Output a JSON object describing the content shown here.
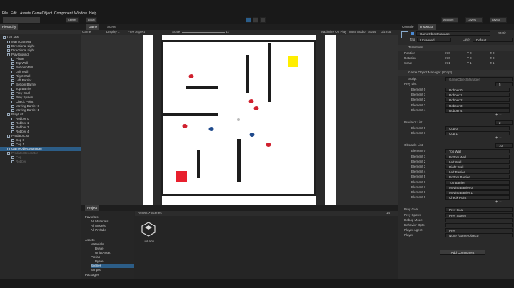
{
  "menu": [
    "File",
    "Edit",
    "Assets",
    "GameObject",
    "Component",
    "Window",
    "Help"
  ],
  "toolbar": {
    "account": "LinLab5",
    "center": "Center",
    "local": "Local",
    "account_btn": "Account",
    "layers": "Layers",
    "layout": "Layout"
  },
  "hierarchy": {
    "tab": "Hierarchy",
    "scene_tab": "Scene",
    "items": [
      {
        "label": "LinLab5",
        "indent": 0,
        "sel": false,
        "dim": false
      },
      {
        "label": "Main Camera",
        "indent": 1,
        "sel": false,
        "dim": false
      },
      {
        "label": "Directional Light",
        "indent": 1,
        "sel": false,
        "dim": false
      },
      {
        "label": "Directional Light",
        "indent": 1,
        "sel": false,
        "dim": false
      },
      {
        "label": "PlayGround",
        "indent": 1,
        "sel": false,
        "dim": false
      },
      {
        "label": "Plane",
        "indent": 2,
        "sel": false,
        "dim": false
      },
      {
        "label": "Top Wall",
        "indent": 2,
        "sel": false,
        "dim": false
      },
      {
        "label": "Bottom Wall",
        "indent": 2,
        "sel": false,
        "dim": false
      },
      {
        "label": "Left Wall",
        "indent": 2,
        "sel": false,
        "dim": false
      },
      {
        "label": "Right Wall",
        "indent": 2,
        "sel": false,
        "dim": false
      },
      {
        "label": "Left Barrier",
        "indent": 2,
        "sel": false,
        "dim": false
      },
      {
        "label": "Bottom Barrier",
        "indent": 2,
        "sel": false,
        "dim": false
      },
      {
        "label": "Top Barrier",
        "indent": 2,
        "sel": false,
        "dim": false
      },
      {
        "label": "Prey Goal",
        "indent": 2,
        "sel": false,
        "dim": false
      },
      {
        "label": "Prey Spawn",
        "indent": 2,
        "sel": false,
        "dim": false
      },
      {
        "label": "Check Point",
        "indent": 2,
        "sel": false,
        "dim": false
      },
      {
        "label": "Moving Barrier 0",
        "indent": 2,
        "sel": false,
        "dim": false
      },
      {
        "label": "Moving Barrier 1",
        "indent": 2,
        "sel": false,
        "dim": false
      },
      {
        "label": "PreyList",
        "indent": 1,
        "sel": false,
        "dim": false
      },
      {
        "label": "Robber 0",
        "indent": 2,
        "sel": false,
        "dim": false
      },
      {
        "label": "Robber 1",
        "indent": 2,
        "sel": false,
        "dim": false
      },
      {
        "label": "Robber 3",
        "indent": 2,
        "sel": false,
        "dim": false
      },
      {
        "label": "Robber 4",
        "indent": 2,
        "sel": false,
        "dim": false
      },
      {
        "label": "PredatorList",
        "indent": 1,
        "sel": false,
        "dim": false
      },
      {
        "label": "Cop 0",
        "indent": 2,
        "sel": false,
        "dim": false
      },
      {
        "label": "Cop 1",
        "indent": 2,
        "sel": false,
        "dim": false
      },
      {
        "label": "GameObjectManager",
        "indent": 1,
        "sel": true,
        "dim": false
      },
      {
        "label": "PredatorDecorator",
        "indent": 1,
        "sel": false,
        "dim": true
      },
      {
        "label": "Cop",
        "indent": 2,
        "sel": false,
        "dim": true
      },
      {
        "label": "Robber",
        "indent": 2,
        "sel": false,
        "dim": true
      }
    ]
  },
  "game": {
    "tab": "Game",
    "scene_tab": "Scene",
    "display": "Display 1",
    "aspect": "Free Aspect",
    "scale": "Scale",
    "scale_value": "1x",
    "maximize": "Maximize On Play",
    "mute": "Mute Audio",
    "stats": "Stats",
    "gizmos": "Gizmos"
  },
  "project": {
    "tab": "Project",
    "console_tab": "Console",
    "favorites": "Favorites",
    "fav_items": [
      "All Materials",
      "All Models",
      "All Prefabs"
    ],
    "assets": "Assets",
    "asset_items": [
      "Materials",
      "ByMe",
      "UnityAsset",
      "Prefab",
      "ByMe",
      "Scenes",
      "Scripts"
    ],
    "packages": "Packages",
    "breadcrumb": "Assets > Scenes",
    "file": "LinLab5",
    "count": "14"
  },
  "inspector": {
    "tab": "Inspector",
    "console_tab": "Console",
    "object_name": "GameObjectManager",
    "static": "Static",
    "tag_label": "Tag",
    "tag": "Untagged",
    "layer_label": "Layer",
    "layer": "Default",
    "transform": "Transform",
    "pos": "Position",
    "rot": "Rotation",
    "scale": "Scale",
    "pos_vals": [
      "X 0",
      "Y 0",
      "Z 0"
    ],
    "rot_vals": [
      "X 0",
      "Y 0",
      "Z 0"
    ],
    "scale_vals": [
      "X 1",
      "Y 1",
      "Z 1"
    ],
    "script_title": "Game Object Manager (Script)",
    "script_label": "Script",
    "script_val": "GameObjectManager",
    "prey_list": "Prey List",
    "prey_count": "5",
    "prey": [
      [
        "Element 0",
        "Robber 0"
      ],
      [
        "Element 1",
        "Robber 1"
      ],
      [
        "Element 2",
        "Robber 2"
      ],
      [
        "Element 3",
        "Robber 3"
      ],
      [
        "Element 4",
        "Robber 4"
      ]
    ],
    "pred_list": "Predator List",
    "pred_count": "2",
    "pred": [
      [
        "Element 0",
        "Cop 0"
      ],
      [
        "Element 1",
        "Cop 1"
      ]
    ],
    "obs_list": "Obstacle List",
    "obs_count": "10",
    "obs": [
      [
        "Element 0",
        "Top Wall"
      ],
      [
        "Element 1",
        "Bottom Wall"
      ],
      [
        "Element 2",
        "Left Wall"
      ],
      [
        "Element 3",
        "Right Wall"
      ],
      [
        "Element 4",
        "Left Barrier"
      ],
      [
        "Element 5",
        "Bottom Barrier"
      ],
      [
        "Element 6",
        "Top Barrier"
      ],
      [
        "Element 7",
        "Moving Barrier 0"
      ],
      [
        "Element 8",
        "Moving Barrier 1"
      ],
      [
        "Element 9",
        "Check Point"
      ]
    ],
    "extra": [
      [
        "Prey Goal",
        "Prey Goal"
      ],
      [
        "Prey Spawn",
        "Prey Spawn"
      ],
      [
        "Debug Mode",
        ""
      ],
      [
        "Behavior Opts",
        ""
      ],
      [
        "Player Agent",
        "Prey"
      ],
      [
        "Player",
        "None (Game Object)"
      ]
    ],
    "add_component": "Add Component"
  }
}
